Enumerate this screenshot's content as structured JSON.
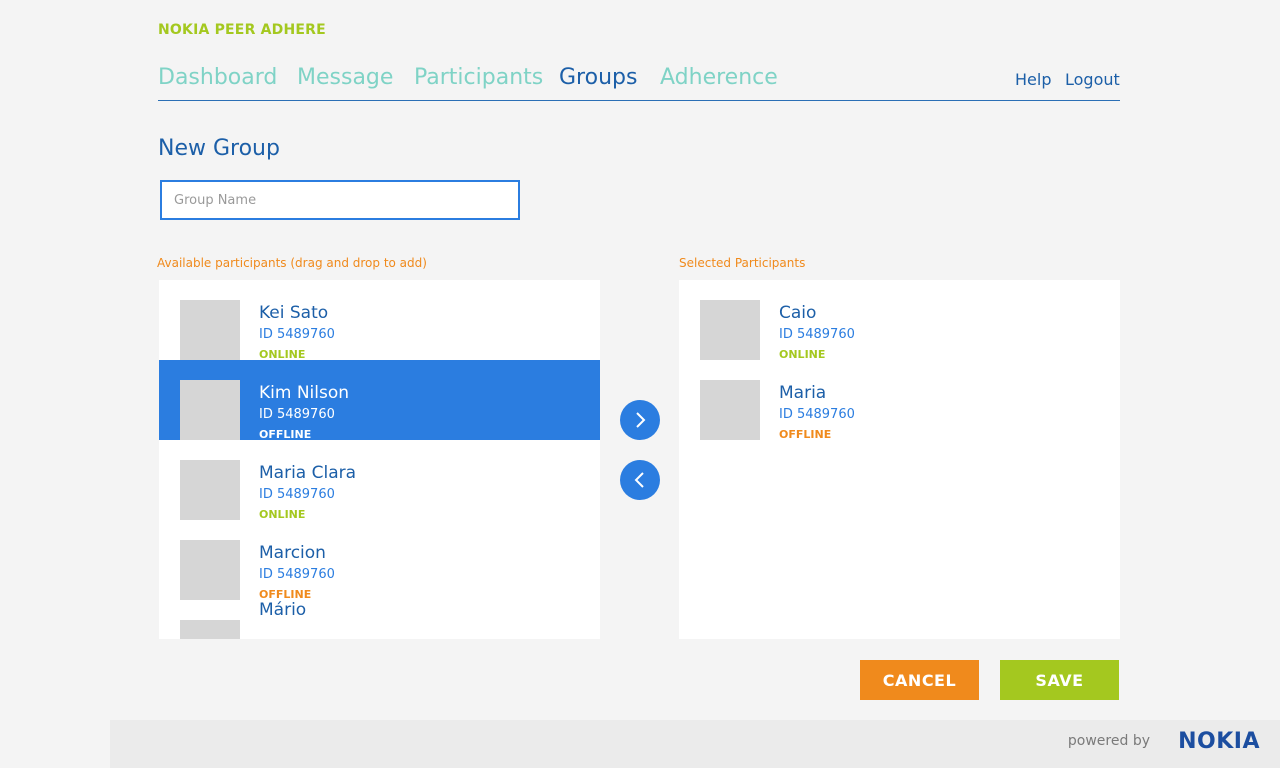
{
  "app": {
    "brand": "NOKIA PEER ADHERE"
  },
  "nav": {
    "items": [
      {
        "label": "Dashboard",
        "active": false
      },
      {
        "label": "Message",
        "active": false
      },
      {
        "label": "Participants",
        "active": false
      },
      {
        "label": "Groups",
        "active": true
      },
      {
        "label": "Adherence",
        "active": false
      }
    ],
    "help": "Help",
    "logout": "Logout"
  },
  "page": {
    "title": "New Group",
    "group_name_placeholder": "Group Name",
    "group_name_value": ""
  },
  "available": {
    "label": "Available participants (drag and drop to add)",
    "items": [
      {
        "name": "Kei Sato",
        "id": "ID 5489760",
        "status": "ONLINE",
        "selected": false
      },
      {
        "name": "Kim Nilson",
        "id": "ID 5489760",
        "status": "OFFLINE",
        "selected": true
      },
      {
        "name": "Maria Clara",
        "id": "ID 5489760",
        "status": "ONLINE",
        "selected": false
      },
      {
        "name": "Marcion",
        "id": "ID 5489760",
        "status": "OFFLINE",
        "selected": false
      },
      {
        "name": "Mário",
        "id": "",
        "status": "",
        "selected": false
      }
    ]
  },
  "selected": {
    "label": "Selected Participants",
    "items": [
      {
        "name": "Caio",
        "id": "ID 5489760",
        "status": "ONLINE"
      },
      {
        "name": "Maria",
        "id": "ID 5489760",
        "status": "OFFLINE"
      }
    ]
  },
  "actions": {
    "cancel": "CANCEL",
    "save": "SAVE"
  },
  "footer": {
    "powered_by": "powered by",
    "logo": "NOKIA"
  },
  "colors": {
    "brand_green": "#a4c81f",
    "nav_teal": "#7fd3c6",
    "primary_blue": "#2b7de0",
    "dark_blue": "#1c5fa8",
    "orange": "#f08a1c",
    "online": "#a4c81f",
    "offline": "#f08a1c"
  },
  "icons": {
    "add": "chevron-right-icon",
    "remove": "chevron-left-icon"
  }
}
